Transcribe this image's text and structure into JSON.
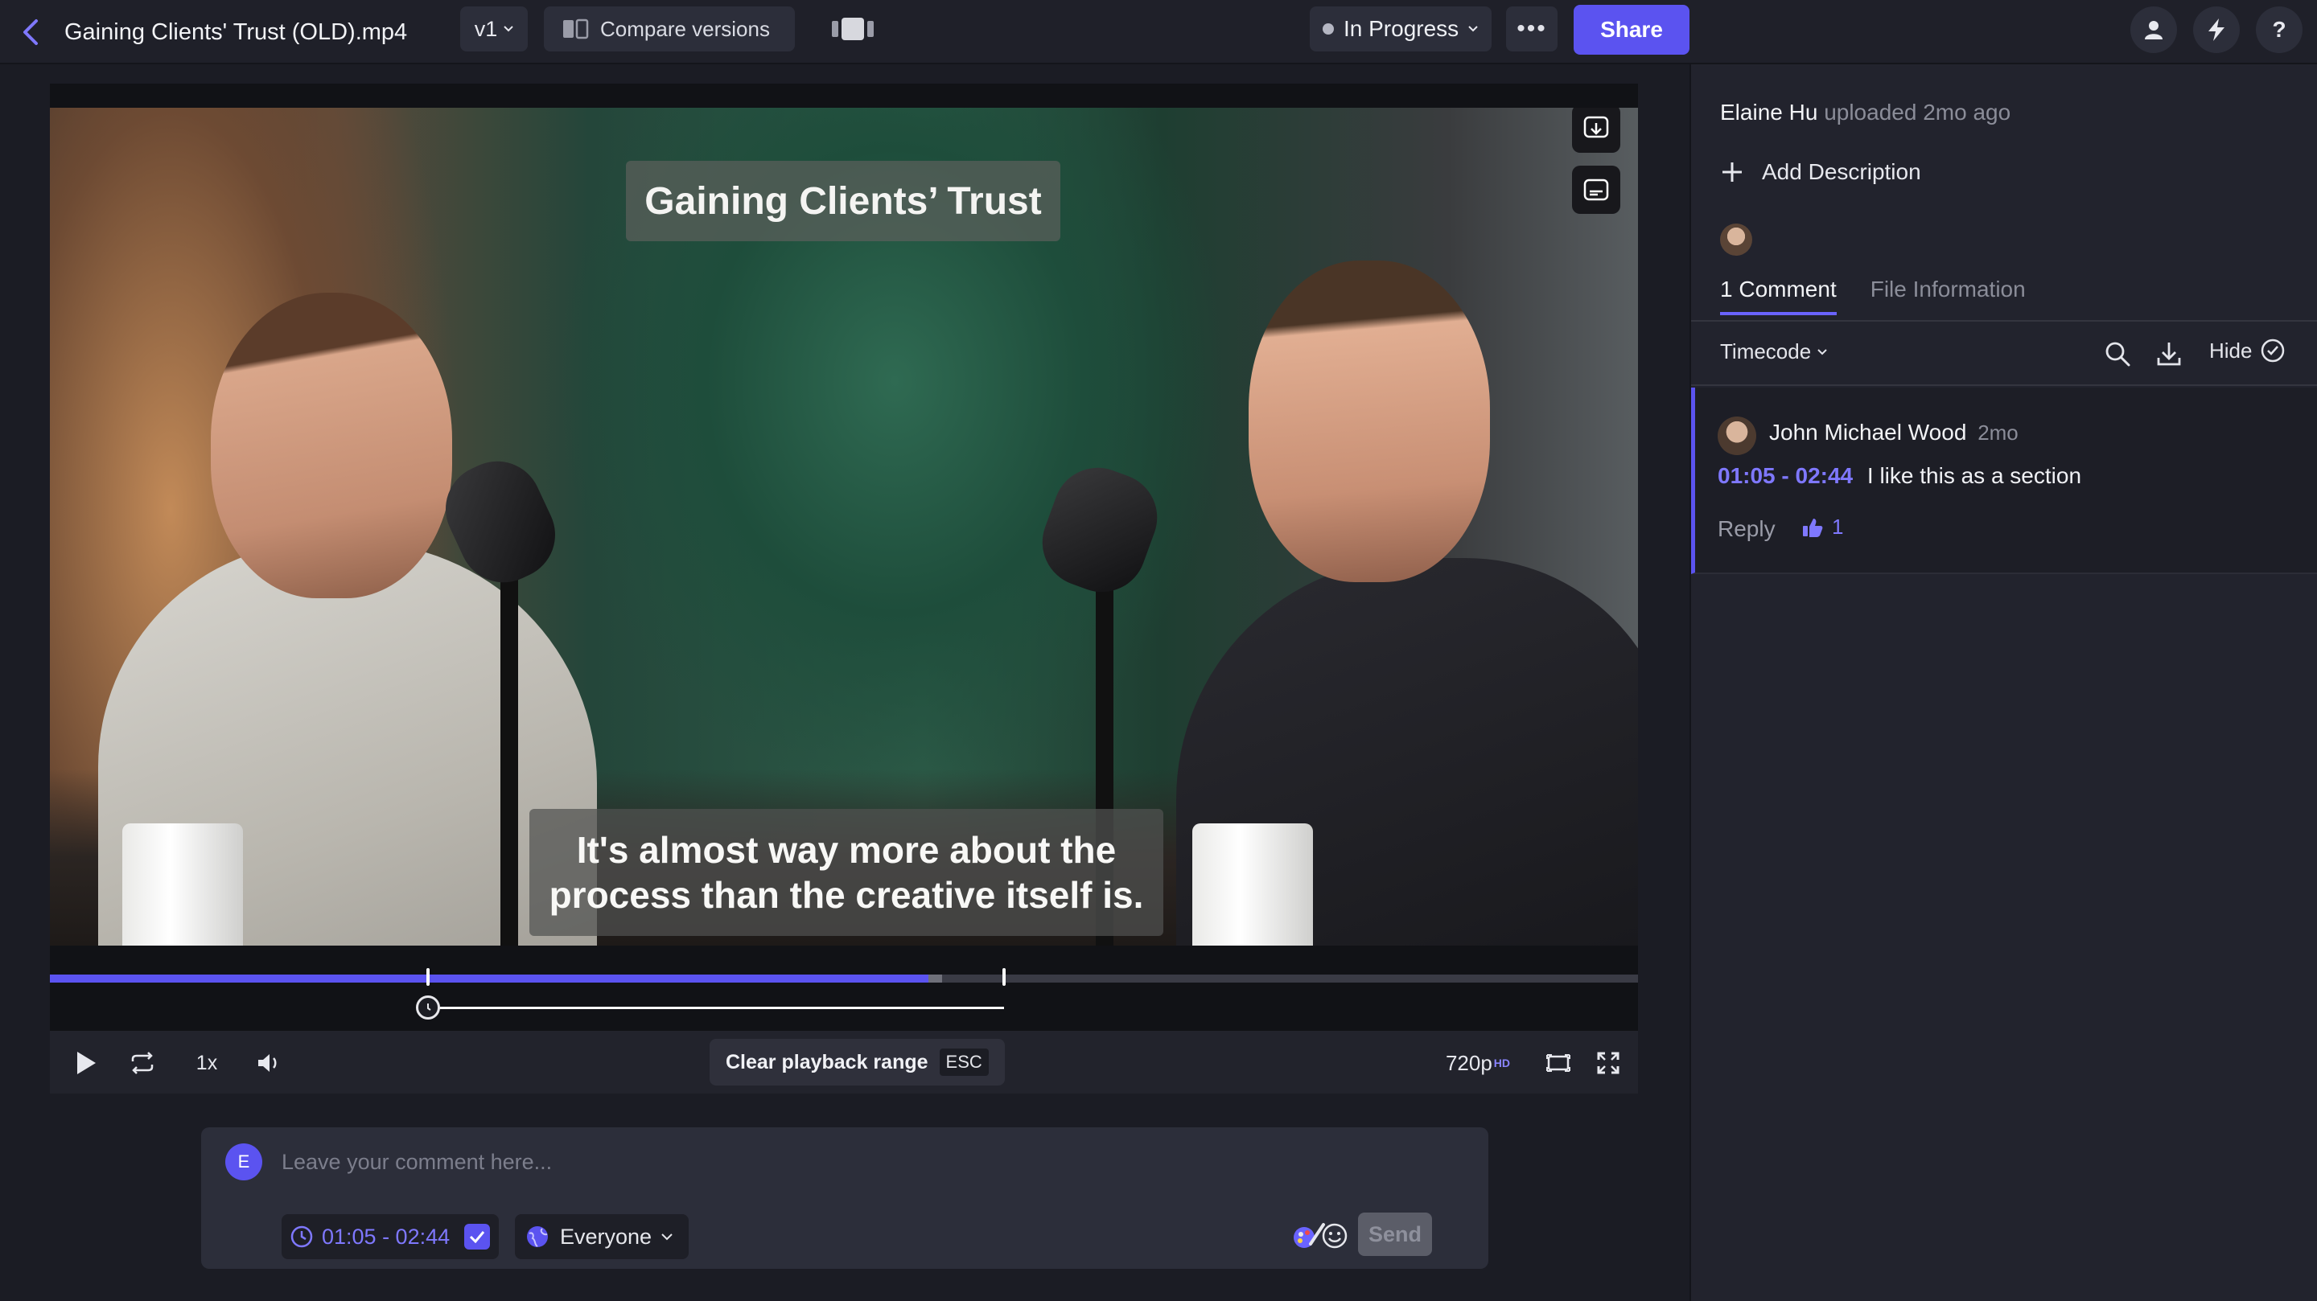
{
  "topbar": {
    "file_title": "Gaining Clients' Trust (OLD).mp4",
    "version": "v1",
    "compare_label": "Compare versions",
    "status": "In Progress",
    "more": "•••",
    "share_label": "Share",
    "help": "?"
  },
  "video": {
    "title_caption": "Gaining Clients’ Trust",
    "subtitle_line1": "It's almost way more about the",
    "subtitle_line2": "process than the creative itself is.",
    "progress": 0.553,
    "buffered": 0.562,
    "range_start": 0.238,
    "range_end": 0.601
  },
  "controls": {
    "speed": "1x",
    "clear_range_label": "Clear playback range",
    "clear_range_key": "ESC",
    "quality": "720p",
    "quality_badge": "HD"
  },
  "composer": {
    "avatar_letter": "E",
    "placeholder": "Leave your comment here...",
    "range": "01:05 - 02:44",
    "audience": "Everyone",
    "send_label": "Send"
  },
  "panel": {
    "uploader_name": "Elaine Hu",
    "uploader_meta": "uploaded 2mo ago",
    "add_description": "Add Description",
    "tabs": [
      {
        "label": "1 Comment"
      },
      {
        "label": "File Information"
      }
    ],
    "sort_label": "Timecode",
    "hide_label": "Hide",
    "comment": {
      "author": "John Michael Wood",
      "time": "2mo",
      "range": "01:05 - 02:44",
      "text": "I like this as a section",
      "reply_label": "Reply",
      "likes": "1"
    }
  },
  "colors": {
    "accent": "#5b53f0",
    "background": "#1b1c24",
    "panel": "#22232d"
  }
}
